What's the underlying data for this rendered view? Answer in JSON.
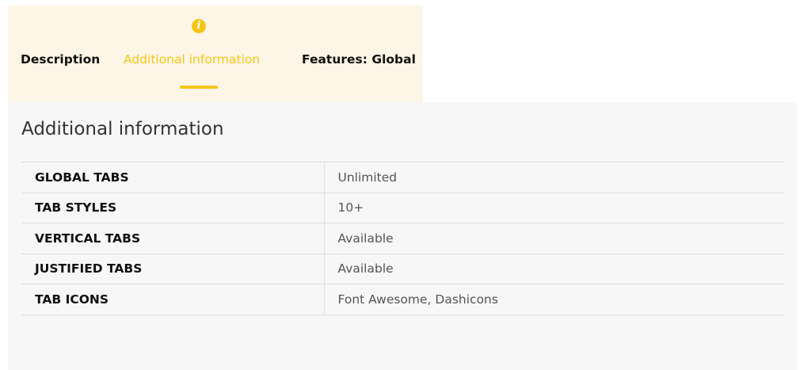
{
  "tabs": {
    "description_label": "Description",
    "additional_label": "Additional information",
    "features_label": "Features: Global",
    "active_icon": "info-icon",
    "accent_color": "#f5c518"
  },
  "panel": {
    "title": "Additional information",
    "rows": [
      {
        "key": "GLOBAL TABS",
        "value": "Unlimited"
      },
      {
        "key": "TAB STYLES",
        "value": "10+"
      },
      {
        "key": "VERTICAL TABS",
        "value": "Available"
      },
      {
        "key": "JUSTIFIED TABS",
        "value": "Available"
      },
      {
        "key": "TAB ICONS",
        "value": "Font Awesome, Dashicons"
      }
    ]
  }
}
